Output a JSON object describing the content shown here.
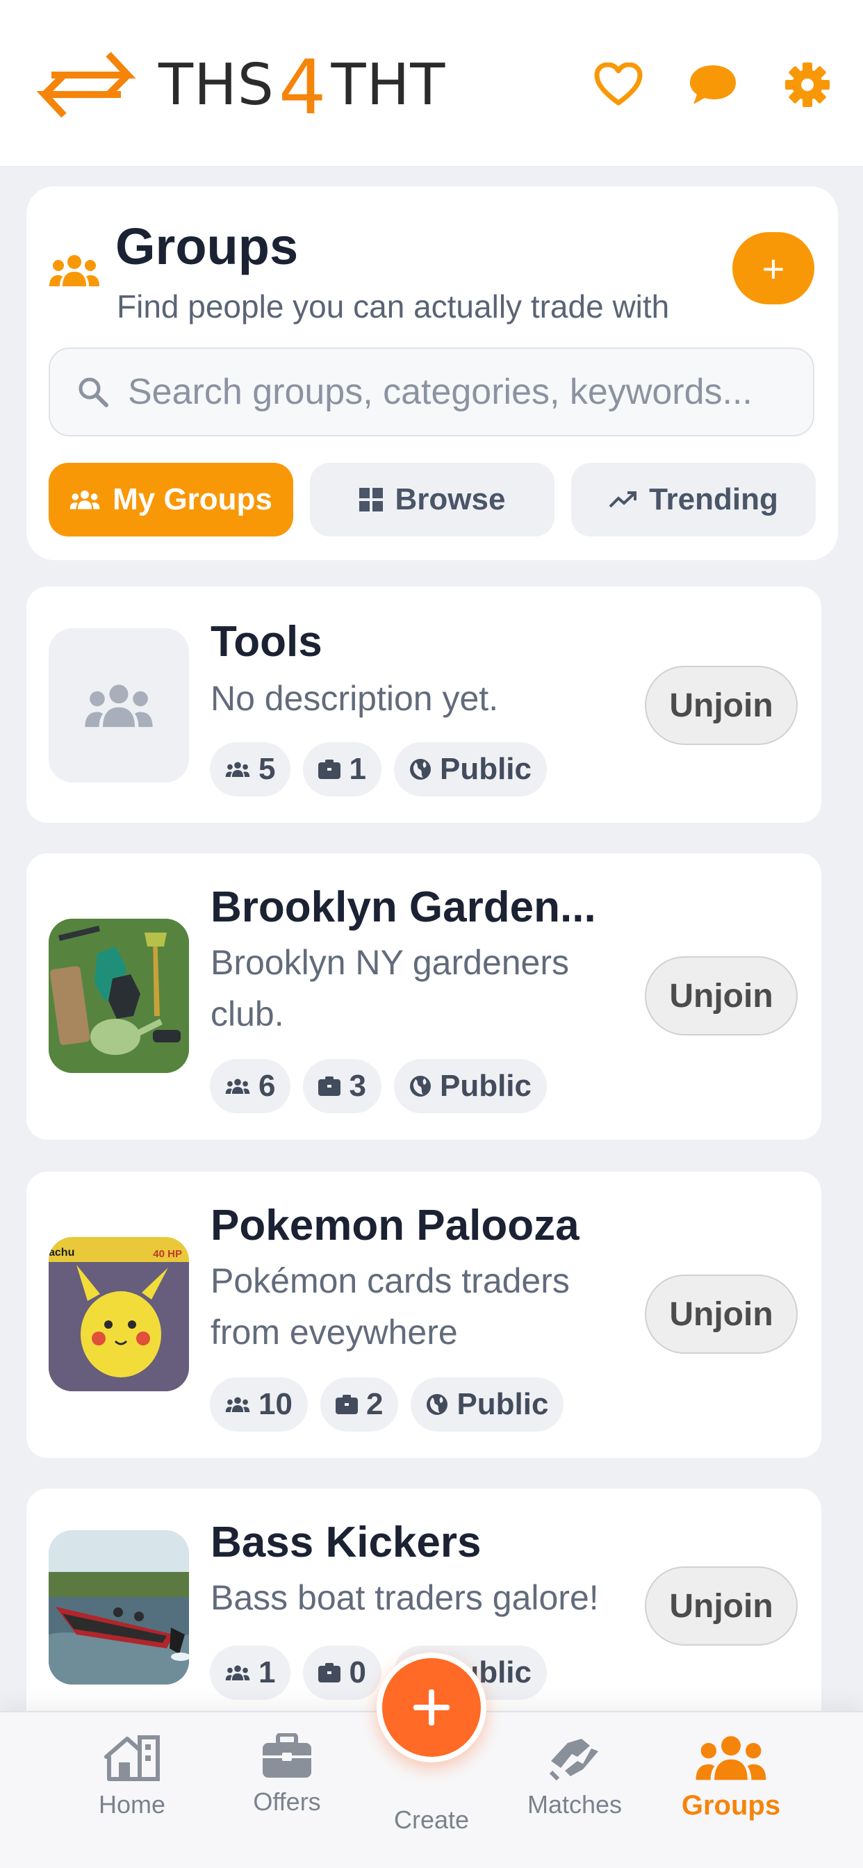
{
  "app": {
    "logo_left": "THS",
    "logo_four": "4",
    "logo_right": "THT"
  },
  "header": {
    "title": "Groups",
    "subtitle": "Find people you can actually trade with",
    "add_label": "+",
    "search_placeholder": "Search groups, categories, keywords...",
    "filters": [
      "My Groups",
      "Browse",
      "Trending"
    ],
    "active_filter": "My Groups"
  },
  "groups": [
    {
      "name": "Tools",
      "description": "No description yet.",
      "members": "5",
      "items": "1",
      "visibility": "Public",
      "action": "Unjoin"
    },
    {
      "name": "Brooklyn Garden...",
      "description": "Brooklyn NY gardeners club.",
      "members": "6",
      "items": "3",
      "visibility": "Public",
      "action": "Unjoin"
    },
    {
      "name": "Pokemon Palooza",
      "description": "Pokémon cards traders from eveywhere",
      "members": "10",
      "items": "2",
      "visibility": "Public",
      "action": "Unjoin"
    },
    {
      "name": "Bass Kickers",
      "description": "Bass boat traders galore!",
      "members": "1",
      "items": "0",
      "visibility": "Public",
      "action": "Unjoin"
    }
  ],
  "card_labels": {
    "pokemon_name": "achu",
    "pokemon_hp": "40 HP"
  },
  "nav": {
    "home": "Home",
    "offers": "Offers",
    "create": "Create",
    "matches": "Matches",
    "groups": "Groups",
    "active": "Groups"
  },
  "colors": {
    "accent": "#f99807",
    "brand_orange": "#f5840b",
    "fab": "#ff6a26",
    "text_dark": "#1b2233"
  },
  "icons": {
    "top": [
      "heart-icon",
      "chat-bubble-icon",
      "gear-icon"
    ],
    "filters": [
      "people-icon",
      "grid-icon",
      "trending-icon"
    ],
    "chips": [
      "people-icon",
      "box-icon",
      "globe-icon"
    ]
  }
}
